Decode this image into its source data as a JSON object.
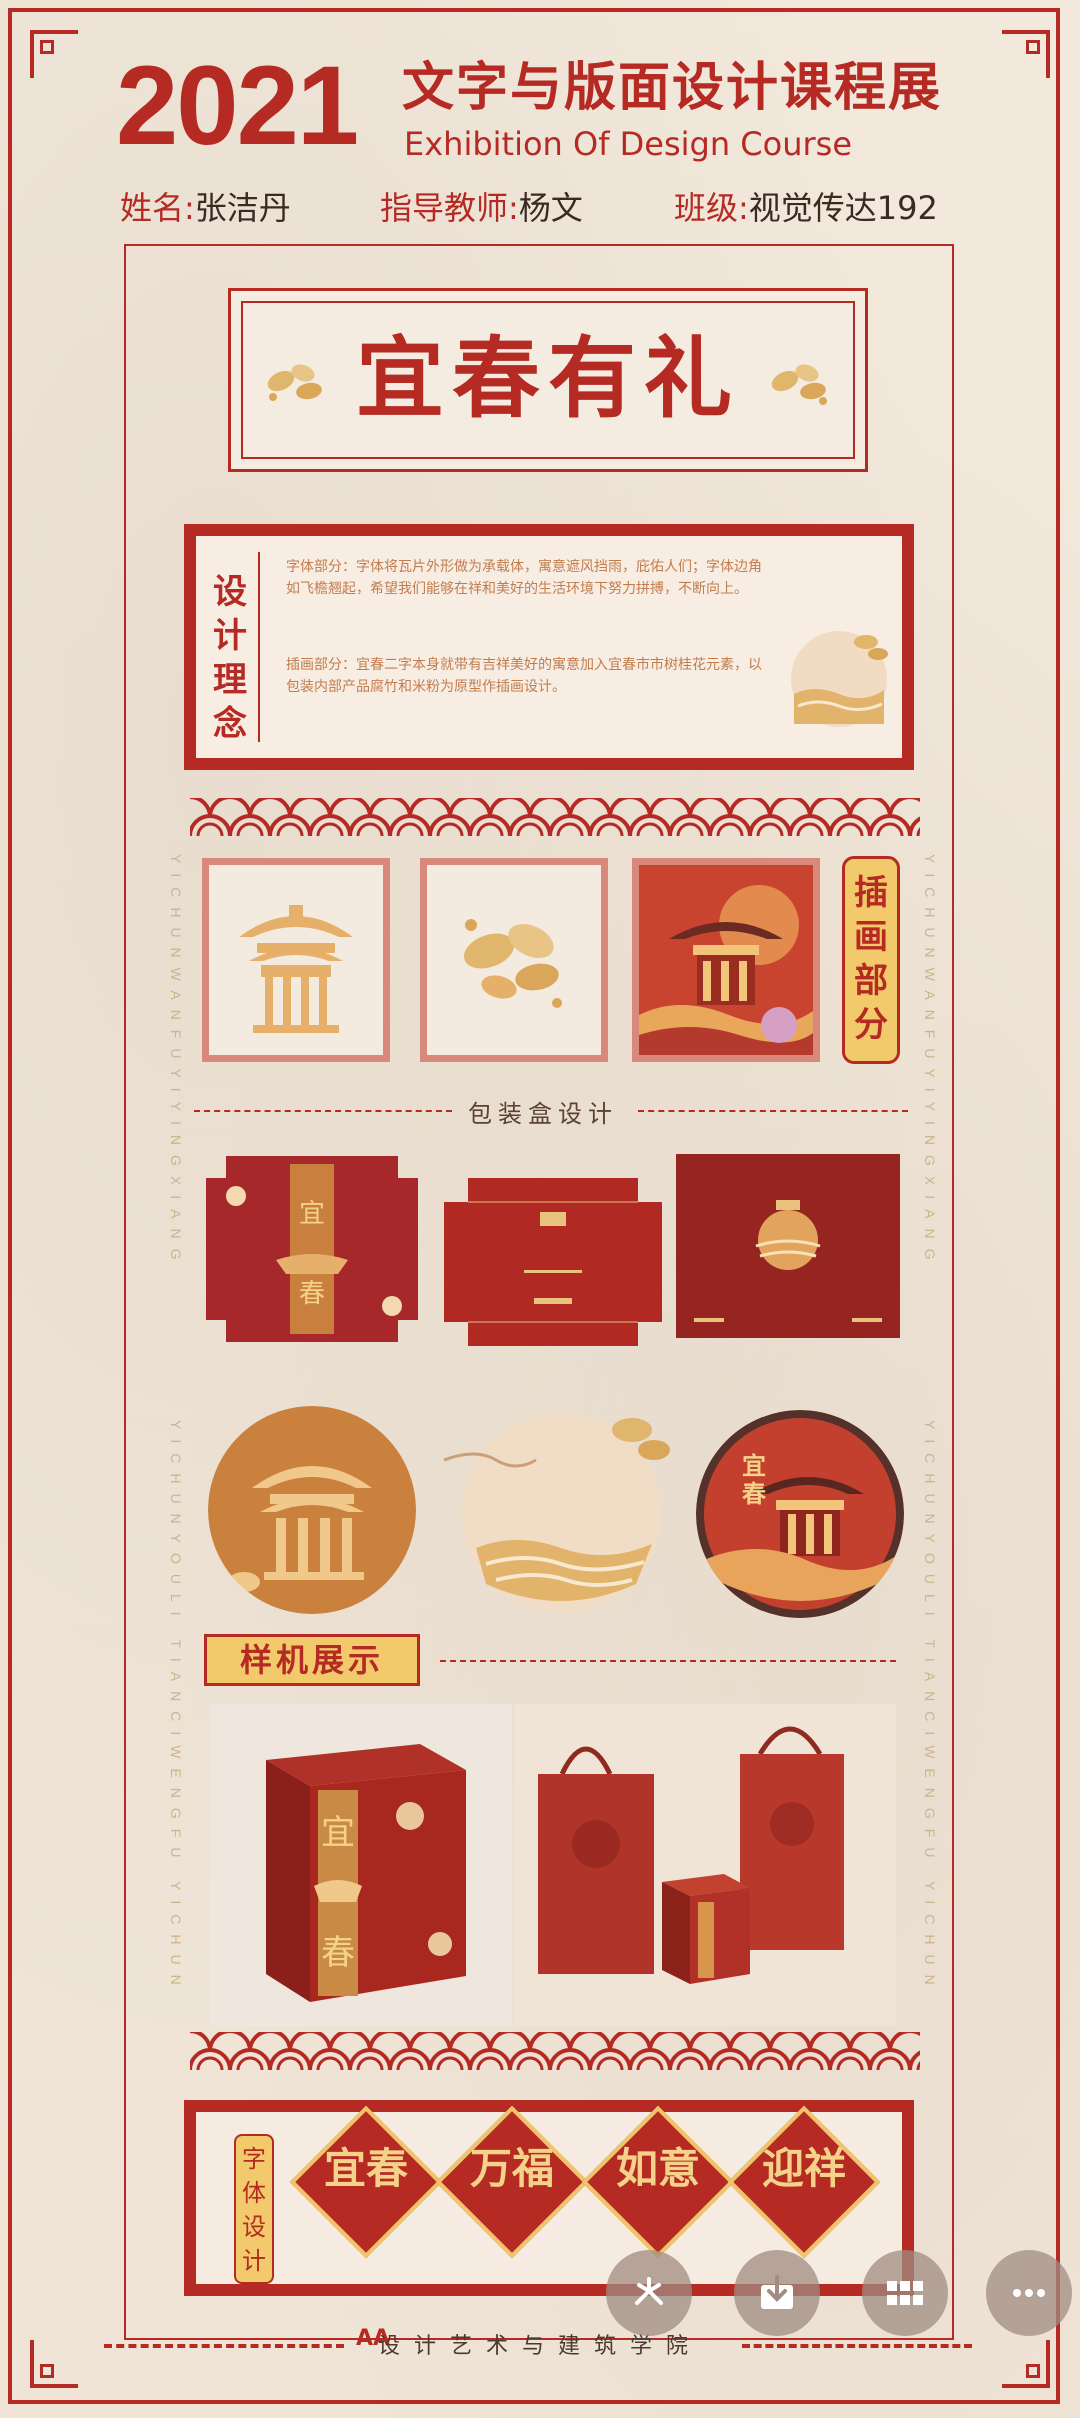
{
  "header": {
    "year": "2021",
    "title": "文字与版面设计课程展",
    "subtitle": "Exhibition Of Design Course",
    "name_label": "姓名:",
    "name_value": "张洁丹",
    "teacher_label": "指导教师:",
    "teacher_value": "杨文",
    "class_label": "班级:",
    "class_value": "视觉传达192"
  },
  "banner": {
    "title": "宜春有礼"
  },
  "concept": {
    "label": "设计理念",
    "para1": "字体部分：字体将瓦片外形做为承载体，寓意遮风挡雨，庇佑人们；字体边角如飞檐翘起，希望我们能够在祥和美好的生活环境下努力拼搏，不断向上。",
    "para2": "插画部分：宜春二字本身就带有吉祥美好的寓意加入宜春市市树桂花元素，以包装内部产品腐竹和米粉为原型作插画设计。"
  },
  "side_text": {
    "left": "YICHUNWANFUYIYINGXIANG",
    "right": "YICHUNWANFUYIYINGXIANG",
    "left2": "YICHUNYOULI TIANCIWENGFU YICHUN",
    "right2": "YICHUNYOULI TIANCIWENGFU YICHUN"
  },
  "illustration": {
    "label": "插画部分"
  },
  "packaging": {
    "title": "包装盒设计"
  },
  "mockup": {
    "label": "样机展示"
  },
  "fonts": {
    "label": "字体设计",
    "items": [
      "宜春",
      "万福",
      "如意",
      "迎祥"
    ]
  },
  "footer": {
    "logo": "AA",
    "text": "设计艺术与建筑学院"
  },
  "fab_icons": [
    "share-icon",
    "download-icon",
    "grid-icon",
    "more-icon"
  ],
  "colors": {
    "accent": "#b52a23",
    "gold": "#e7c07a",
    "paper": "#efe6da"
  }
}
